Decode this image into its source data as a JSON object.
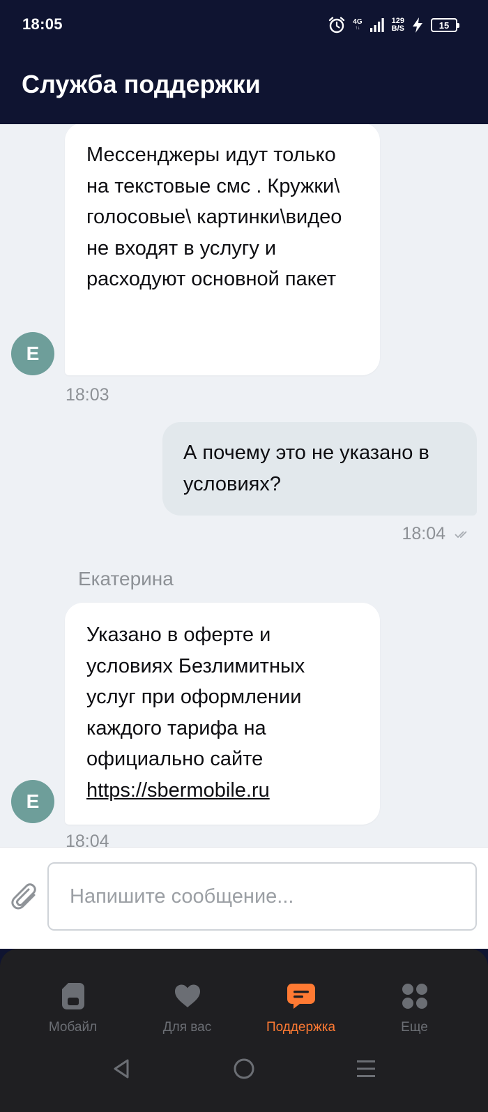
{
  "status_bar": {
    "time": "18:05",
    "network": "4G",
    "network_sub": "↑↓",
    "speed_value": "129",
    "speed_unit": "B/S",
    "battery": "15"
  },
  "header": {
    "title": "Служба поддержки"
  },
  "chat": {
    "messages": [
      {
        "direction": "incoming",
        "avatar": "Е",
        "text": "Мессенджеры идут только на текстовые смс . Кружки\\ голосовые\\ картинки\\видео не входят в услугу и расходуют основной пакет",
        "time": "18:03"
      },
      {
        "direction": "outgoing",
        "text": "А почему это не указано в условиях?",
        "time": "18:04"
      },
      {
        "direction": "incoming",
        "sender": "Екатерина",
        "avatar": "Е",
        "text": "Указано в оферте и условиях Безлимитных услуг при оформлении каждого тарифа на официально сайте",
        "link": "https://sbermobile.ru",
        "time": "18:04"
      }
    ]
  },
  "composer": {
    "placeholder": "Напишите сообщение...",
    "value": ""
  },
  "bottom_nav": {
    "items": [
      {
        "label": "Мобайл",
        "icon": "sim-card-icon",
        "active": false
      },
      {
        "label": "Для вас",
        "icon": "heart-icon",
        "active": false
      },
      {
        "label": "Поддержка",
        "icon": "chat-bubble-icon",
        "active": true
      },
      {
        "label": "Еще",
        "icon": "grid-dots-icon",
        "active": false
      }
    ]
  },
  "colors": {
    "header_bg": "#0f1431",
    "chat_bg": "#eef1f5",
    "accent": "#ff7a33",
    "avatar": "#6e9e9a",
    "outgoing_bubble": "#e2e8ec",
    "nav_bg": "#1f1f22"
  }
}
